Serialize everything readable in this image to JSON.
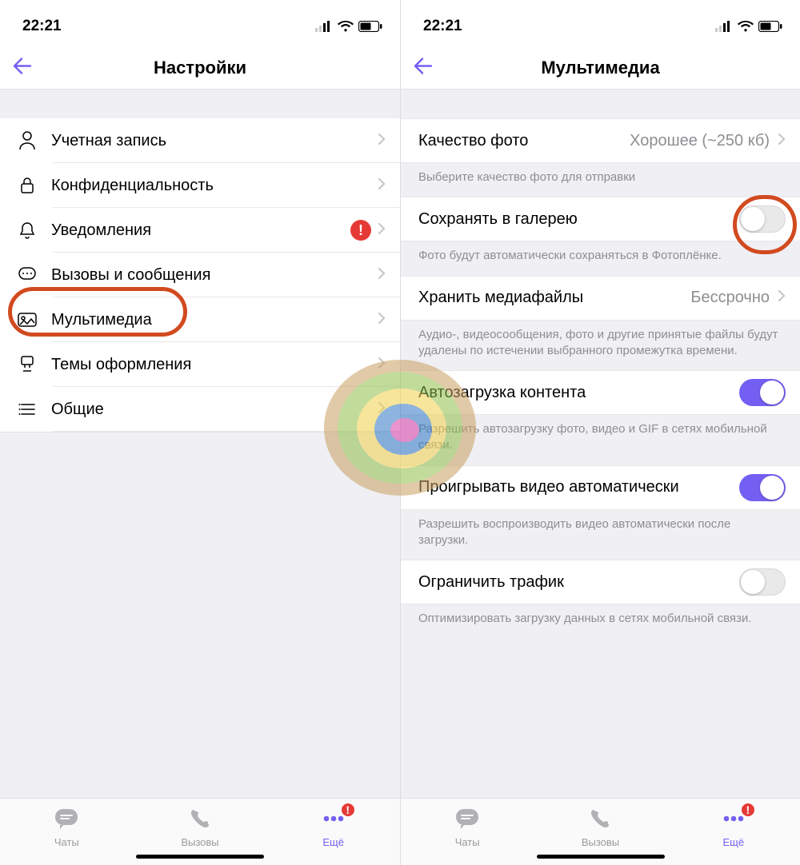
{
  "status": {
    "time": "22:21"
  },
  "left": {
    "title": "Настройки",
    "items": [
      {
        "id": "account",
        "label": "Учетная запись"
      },
      {
        "id": "privacy",
        "label": "Конфиденциальность"
      },
      {
        "id": "notif",
        "label": "Уведомления",
        "alert": "!"
      },
      {
        "id": "calls",
        "label": "Вызовы и сообщения"
      },
      {
        "id": "media",
        "label": "Мультимедиа"
      },
      {
        "id": "themes",
        "label": "Темы оформления"
      },
      {
        "id": "general",
        "label": "Общие"
      }
    ]
  },
  "right": {
    "title": "Мультимедиа",
    "photo_quality": {
      "label": "Качество фото",
      "value": "Хорошее (~250 кб)"
    },
    "photo_quality_footer": "Выберите качество фото для отправки",
    "save_gallery": {
      "label": "Сохранять в галерею",
      "on": false
    },
    "save_gallery_footer": "Фото будут автоматически сохраняться в Фотоплёнке.",
    "store_media": {
      "label": "Хранить медиафайлы",
      "value": "Бессрочно"
    },
    "store_media_footer": "Аудио-, видеосообщения, фото и другие принятые файлы будут удалены по истечении выбранного промежутка времени.",
    "auto_download": {
      "label": "Автозагрузка контента",
      "on": true
    },
    "auto_download_footer": "Разрешить автозагрузку фото, видео и GIF в сетях мобильной связи.",
    "autoplay_video": {
      "label": "Проигрывать видео автоматически",
      "on": true
    },
    "autoplay_video_footer": "Разрешить воспроизводить видео автоматически после загрузки.",
    "limit_traffic": {
      "label": "Ограничить трафик",
      "on": false
    },
    "limit_traffic_footer": "Оптимизировать загрузку данных в сетях мобильной связи."
  },
  "tabs": {
    "chats": "Чаты",
    "calls": "Вызовы",
    "more": "Ещё",
    "more_alert": "!"
  }
}
